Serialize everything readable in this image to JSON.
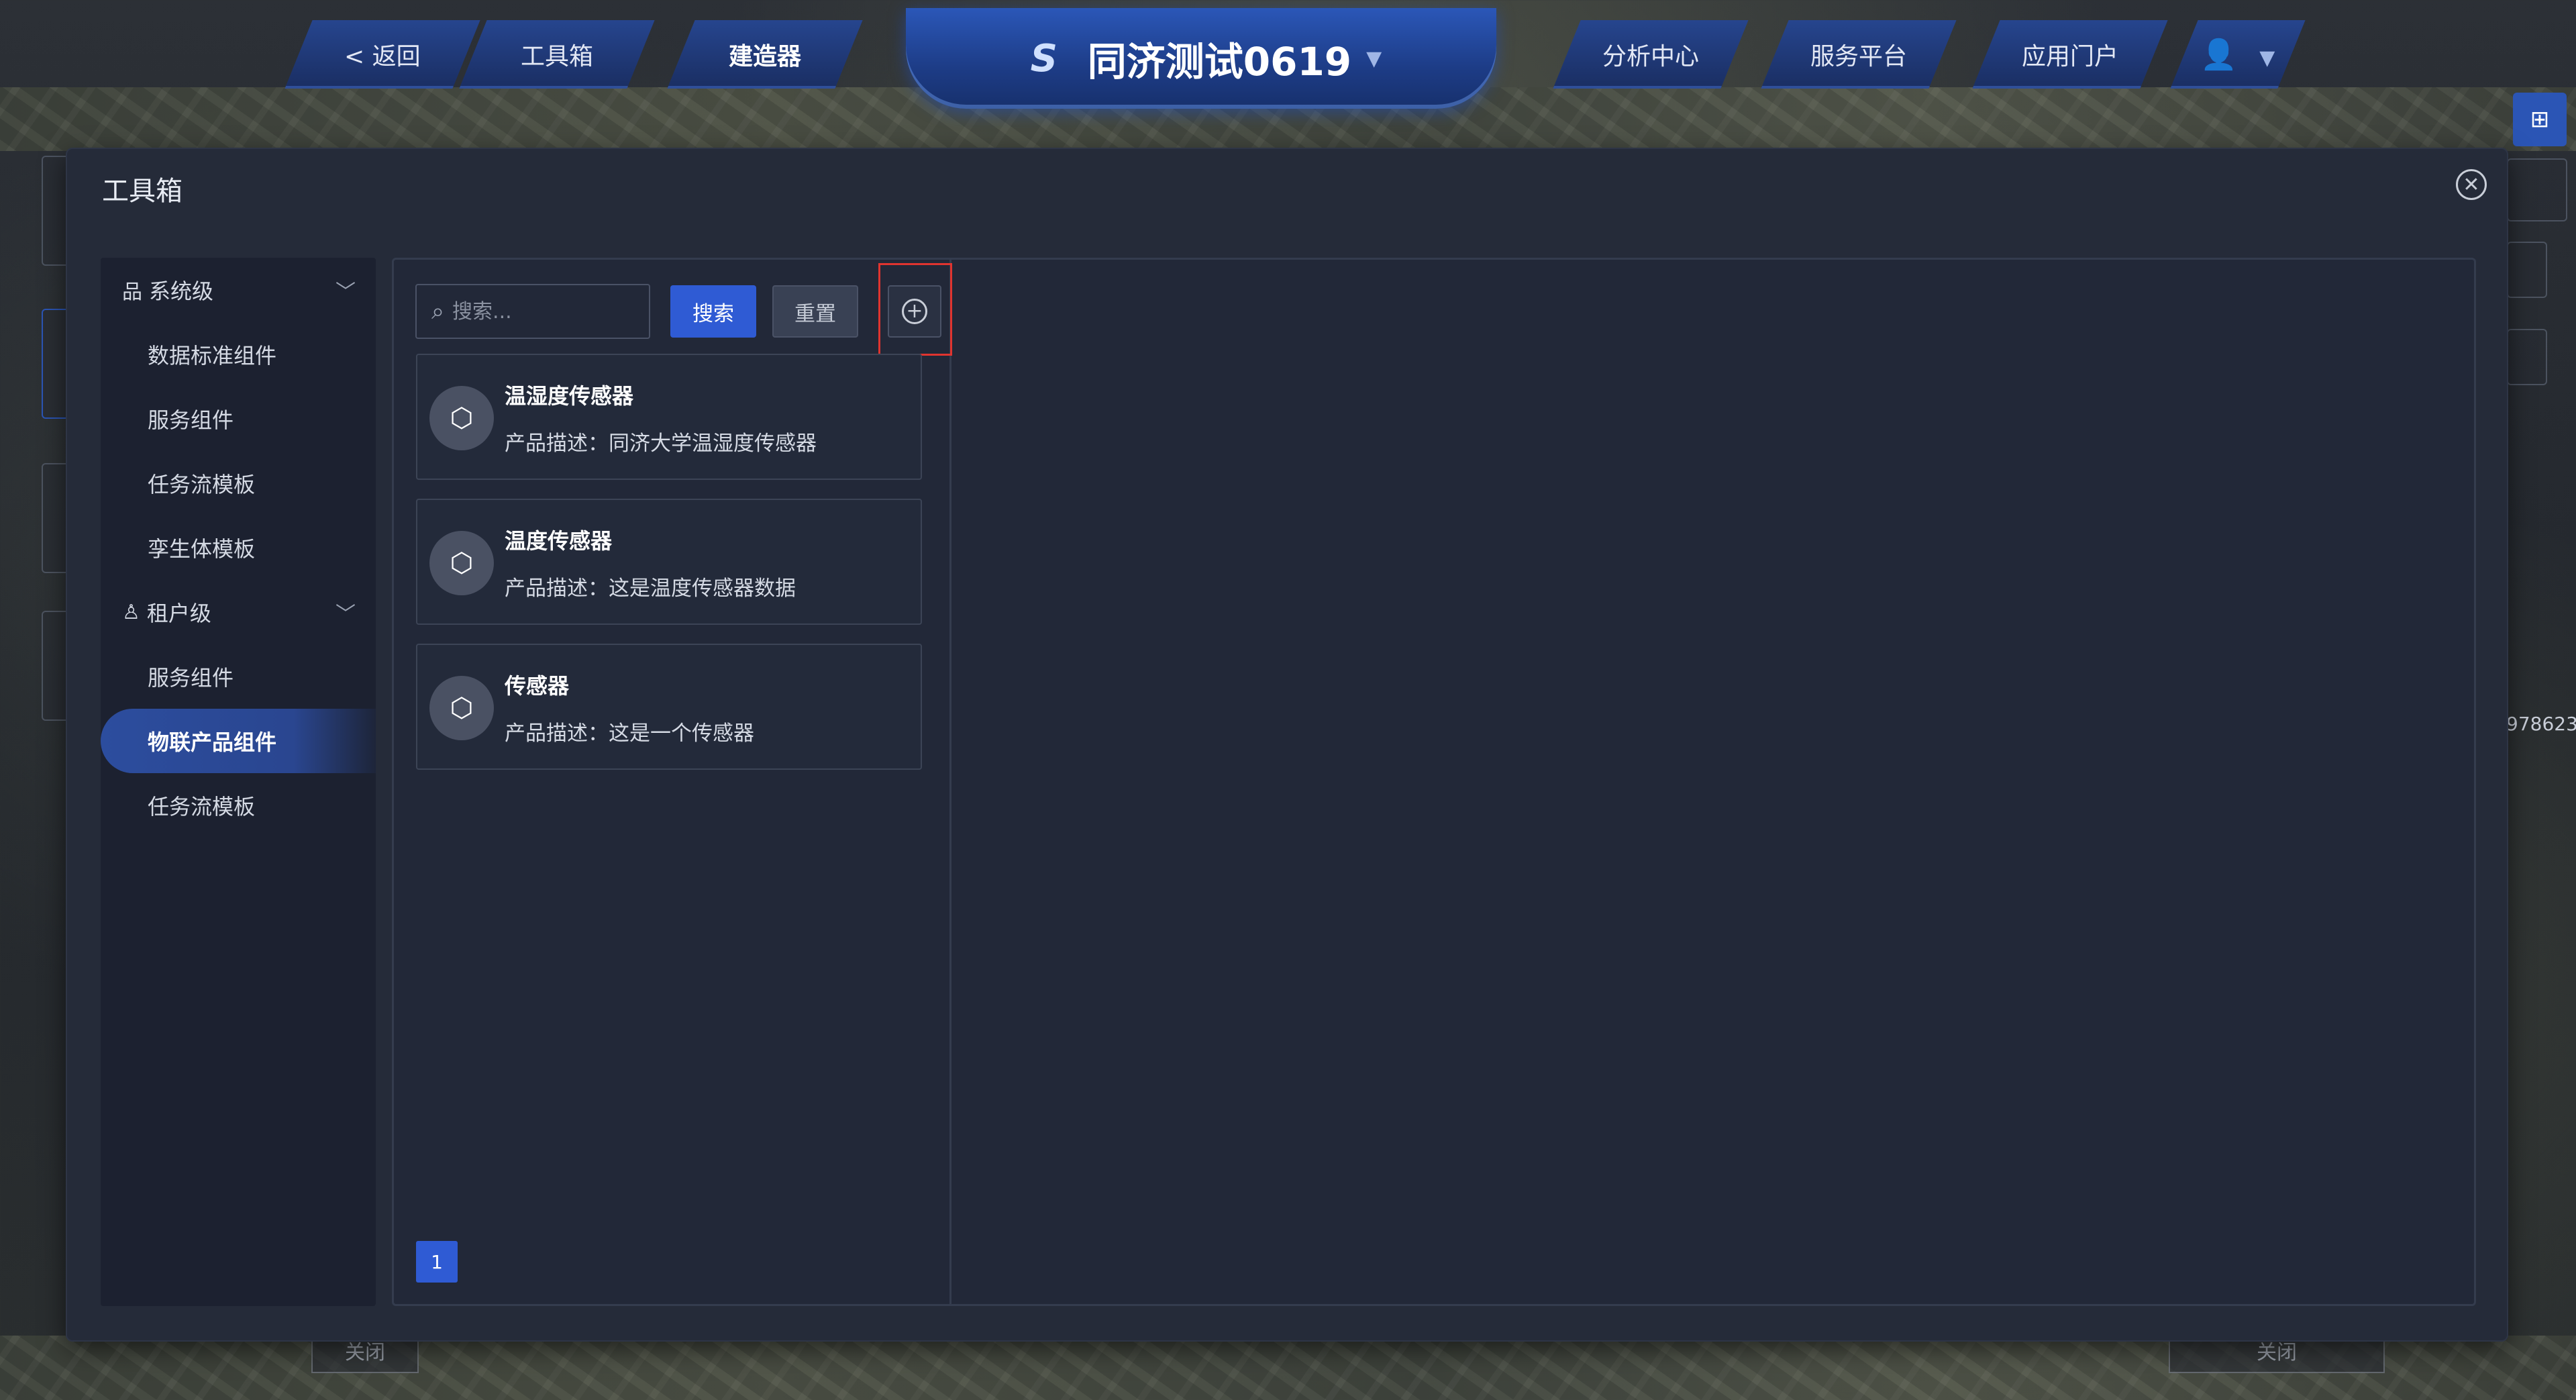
{
  "nav": {
    "back": "< 返回",
    "toolbox": "工具箱",
    "builder": "建造器",
    "project_title": "同济测试0619",
    "analysis": "分析中心",
    "service_platform": "服务平台",
    "app_portal": "应用门户"
  },
  "background": {
    "number_fragment": "978623",
    "close_left": "关闭",
    "close_right": "关闭"
  },
  "modal": {
    "title": "工具箱"
  },
  "sidebar": {
    "system_group": "系统级",
    "system_items": [
      "数据标准组件",
      "服务组件",
      "任务流模板",
      "孪生体模板"
    ],
    "tenant_group": "租户级",
    "tenant_items": [
      "服务组件",
      "物联产品组件",
      "任务流模板"
    ],
    "active_item": "物联产品组件"
  },
  "search": {
    "placeholder": "搜索...",
    "search_label": "搜索",
    "reset_label": "重置"
  },
  "products": [
    {
      "name": "温湿度传感器",
      "desc": "产品描述：同济大学温湿度传感器"
    },
    {
      "name": "温度传感器",
      "desc": "产品描述：这是温度传感器数据"
    },
    {
      "name": "传感器",
      "desc": "产品描述：这是一个传感器"
    }
  ],
  "pagination": {
    "current": "1"
  },
  "colors": {
    "accent": "#2f5bd4",
    "highlight_box": "#e0342f",
    "modal_bg": "#252b39"
  }
}
